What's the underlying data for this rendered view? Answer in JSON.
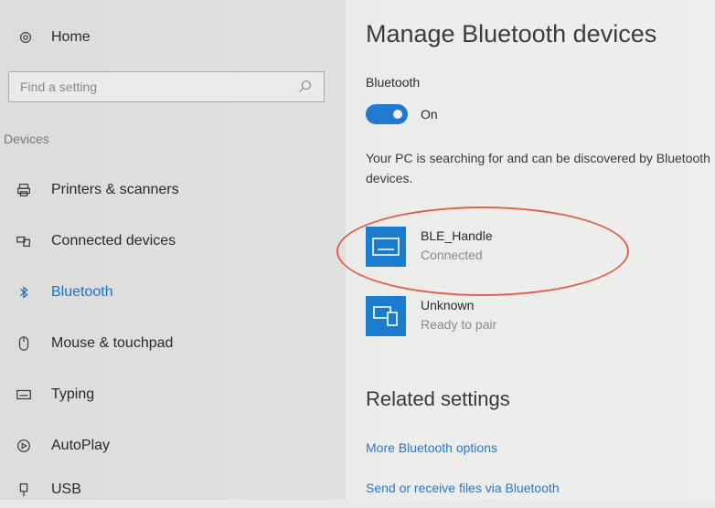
{
  "sidebar": {
    "home_label": "Home",
    "search_placeholder": "Find a setting",
    "section_label": "Devices",
    "items": [
      {
        "label": "Printers & scanners",
        "icon": "printer-icon"
      },
      {
        "label": "Connected devices",
        "icon": "connected-devices-icon"
      },
      {
        "label": "Bluetooth",
        "icon": "bluetooth-icon",
        "active": true
      },
      {
        "label": "Mouse & touchpad",
        "icon": "mouse-icon"
      },
      {
        "label": "Typing",
        "icon": "keyboard-icon"
      },
      {
        "label": "AutoPlay",
        "icon": "autoplay-icon"
      },
      {
        "label": "USB",
        "icon": "usb-icon"
      }
    ]
  },
  "main": {
    "title": "Manage Bluetooth devices",
    "bluetooth_label": "Bluetooth",
    "toggle_state": "On",
    "description": "Your PC is searching for and can be discovered by Bluetooth devices.",
    "devices": [
      {
        "name": "BLE_Handle",
        "status": "Connected",
        "icon": "keyboard-device-icon"
      },
      {
        "name": "Unknown",
        "status": "Ready to pair",
        "icon": "pc-device-icon"
      }
    ],
    "related_title": "Related settings",
    "links": [
      "More Bluetooth options",
      "Send or receive files via Bluetooth"
    ]
  },
  "colors": {
    "accent": "#1f7ad0",
    "highlight_ring": "#e0604f"
  }
}
